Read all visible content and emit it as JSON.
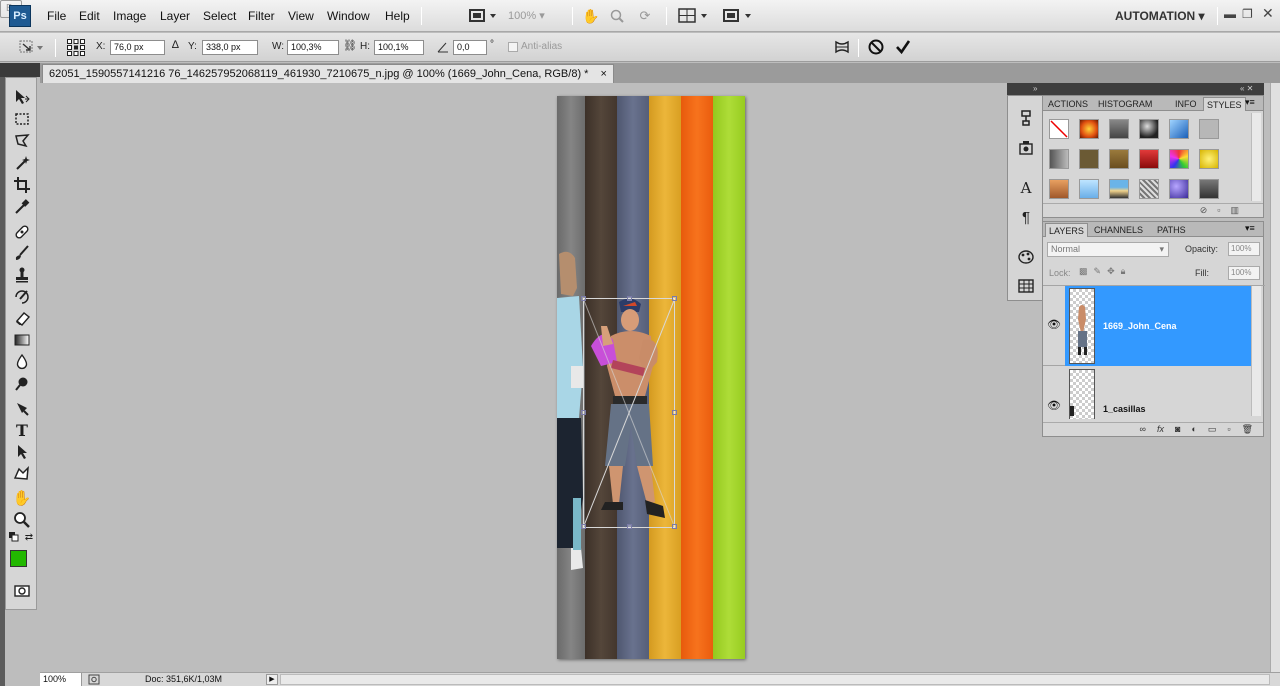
{
  "app": {
    "logo_text": "Ps"
  },
  "menu": [
    "File",
    "Edit",
    "Image",
    "Layer",
    "Select",
    "Filter",
    "View",
    "Window",
    "Help"
  ],
  "menubar": {
    "bridge_label": "Br",
    "zoom_value": "100%",
    "workspace": "AUTOMATION"
  },
  "options_bar": {
    "x_label": "X:",
    "x_value": "76,0 px",
    "y_label": "Y:",
    "y_value": "338,0 px",
    "w_label": "W:",
    "w_value": "100,3%",
    "h_label": "H:",
    "h_value": "100,1%",
    "angle_value": "0,0",
    "skew_unit": "°",
    "antialias_label": "Anti-alias"
  },
  "document": {
    "tab_title": "62051_1590557141216 76_146257952068119_461930_7210675_n.jpg @ 100% (1669_John_Cena, RGB/8) *",
    "close_glyph": "×"
  },
  "status": {
    "zoom": "100%",
    "doc_info": "Doc: 351,6K/1,03M"
  },
  "styles_panel": {
    "tabs": [
      "ACTIONS",
      "HISTOGRAM",
      "INFO",
      "STYLES"
    ],
    "active_tab": "STYLES"
  },
  "layers_panel": {
    "tabs": [
      "LAYERS",
      "CHANNELS",
      "PATHS"
    ],
    "active_tab": "LAYERS",
    "blend_mode": "Normal",
    "opacity_label": "Opacity:",
    "opacity_value": "100%",
    "lock_label": "Lock:",
    "fill_label": "Fill:",
    "fill_value": "100%",
    "layers": [
      {
        "name": "1669_John_Cena",
        "selected": true
      },
      {
        "name": "1_casillas",
        "selected": false
      }
    ],
    "footer_icons": [
      "link-icon",
      "fx-icon",
      "mask-icon",
      "adjustment-icon",
      "group-icon",
      "new-layer-icon",
      "trash-icon"
    ]
  },
  "colors": {
    "foreground": "#22b800",
    "background": "#ffffff",
    "selection": "#3399ff",
    "stripes": [
      "#7a7a7a",
      "#4b3d33",
      "#5c6580",
      "#e1a82b",
      "#f06414",
      "#9fd428"
    ]
  }
}
